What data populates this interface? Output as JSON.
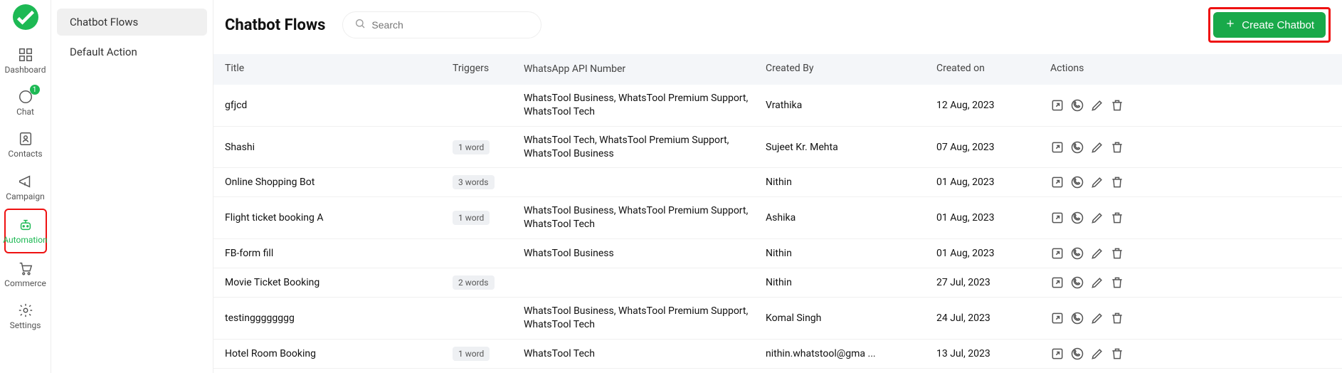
{
  "nav": {
    "items": [
      {
        "label": "Dashboard"
      },
      {
        "label": "Chat",
        "badge": "1"
      },
      {
        "label": "Contacts"
      },
      {
        "label": "Campaign"
      },
      {
        "label": "Automation"
      },
      {
        "label": "Commerce"
      },
      {
        "label": "Settings"
      }
    ]
  },
  "sidebar": {
    "items": [
      {
        "label": "Chatbot Flows"
      },
      {
        "label": "Default Action"
      }
    ]
  },
  "header": {
    "title": "Chatbot Flows",
    "search_placeholder": "Search",
    "create_label": "Create Chatbot"
  },
  "table": {
    "columns": {
      "title": "Title",
      "triggers": "Triggers",
      "wapi": "WhatsApp API Number",
      "by": "Created By",
      "on": "Created on",
      "actions": "Actions"
    },
    "rows": [
      {
        "title": "gfjcd",
        "triggers": "",
        "wapi": "WhatsTool Business, WhatsTool Premium Support, WhatsTool Tech",
        "by": "Vrathika",
        "on": "12 Aug, 2023"
      },
      {
        "title": "Shashi",
        "triggers": "1 word",
        "wapi": "WhatsTool Tech, WhatsTool Premium Support, WhatsTool Business",
        "by": "Sujeet Kr. Mehta",
        "on": "07 Aug, 2023"
      },
      {
        "title": "Online Shopping Bot",
        "triggers": "3 words",
        "wapi": "",
        "by": "Nithin",
        "on": "01 Aug, 2023"
      },
      {
        "title": "Flight ticket booking A",
        "triggers": "1 word",
        "wapi": "WhatsTool Business, WhatsTool Premium Support, WhatsTool Tech",
        "by": "Ashika",
        "on": "01 Aug, 2023"
      },
      {
        "title": "FB-form fill",
        "triggers": "",
        "wapi": "WhatsTool Business",
        "by": "Nithin",
        "on": "01 Aug, 2023"
      },
      {
        "title": "Movie Ticket Booking",
        "triggers": "2 words",
        "wapi": "",
        "by": "Nithin",
        "on": "27 Jul, 2023"
      },
      {
        "title": "testingggggggg",
        "triggers": "",
        "wapi": "WhatsTool Business, WhatsTool Premium Support, WhatsTool Tech",
        "by": "Komal Singh",
        "on": "24 Jul, 2023"
      },
      {
        "title": "Hotel Room Booking",
        "triggers": "1 word",
        "wapi": "WhatsTool Tech",
        "by": "nithin.whatstool@gma ...",
        "on": "13 Jul, 2023"
      }
    ]
  }
}
